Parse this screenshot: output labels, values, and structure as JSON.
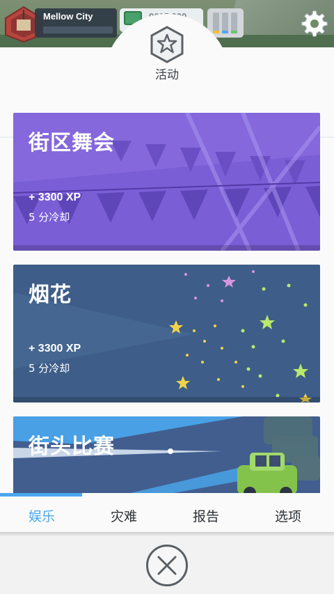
{
  "hud": {
    "city_name": "Mellow City",
    "money": "9615 000",
    "settings_icon": "gear-icon",
    "stat_colors": [
      "#f2c232",
      "#4aa7ee",
      "#6cc46c"
    ]
  },
  "panel": {
    "title": "活动",
    "icon": "star-hex-icon"
  },
  "events": [
    {
      "title": "街区舞会",
      "xp": "+ 3300 XP",
      "cooldown": "5 分冷却",
      "color": "#7c5fd6"
    },
    {
      "title": "烟花",
      "xp": "+ 3300 XP",
      "cooldown": "5 分冷却",
      "color": "#3f5f8a"
    },
    {
      "title": "街头比赛",
      "color": "#425f8f"
    }
  ],
  "tabs": [
    {
      "label": "娱乐",
      "active": true
    },
    {
      "label": "灾难",
      "active": false
    },
    {
      "label": "报告",
      "active": false
    },
    {
      "label": "选项",
      "active": false
    }
  ],
  "close_icon": "close-x-icon"
}
